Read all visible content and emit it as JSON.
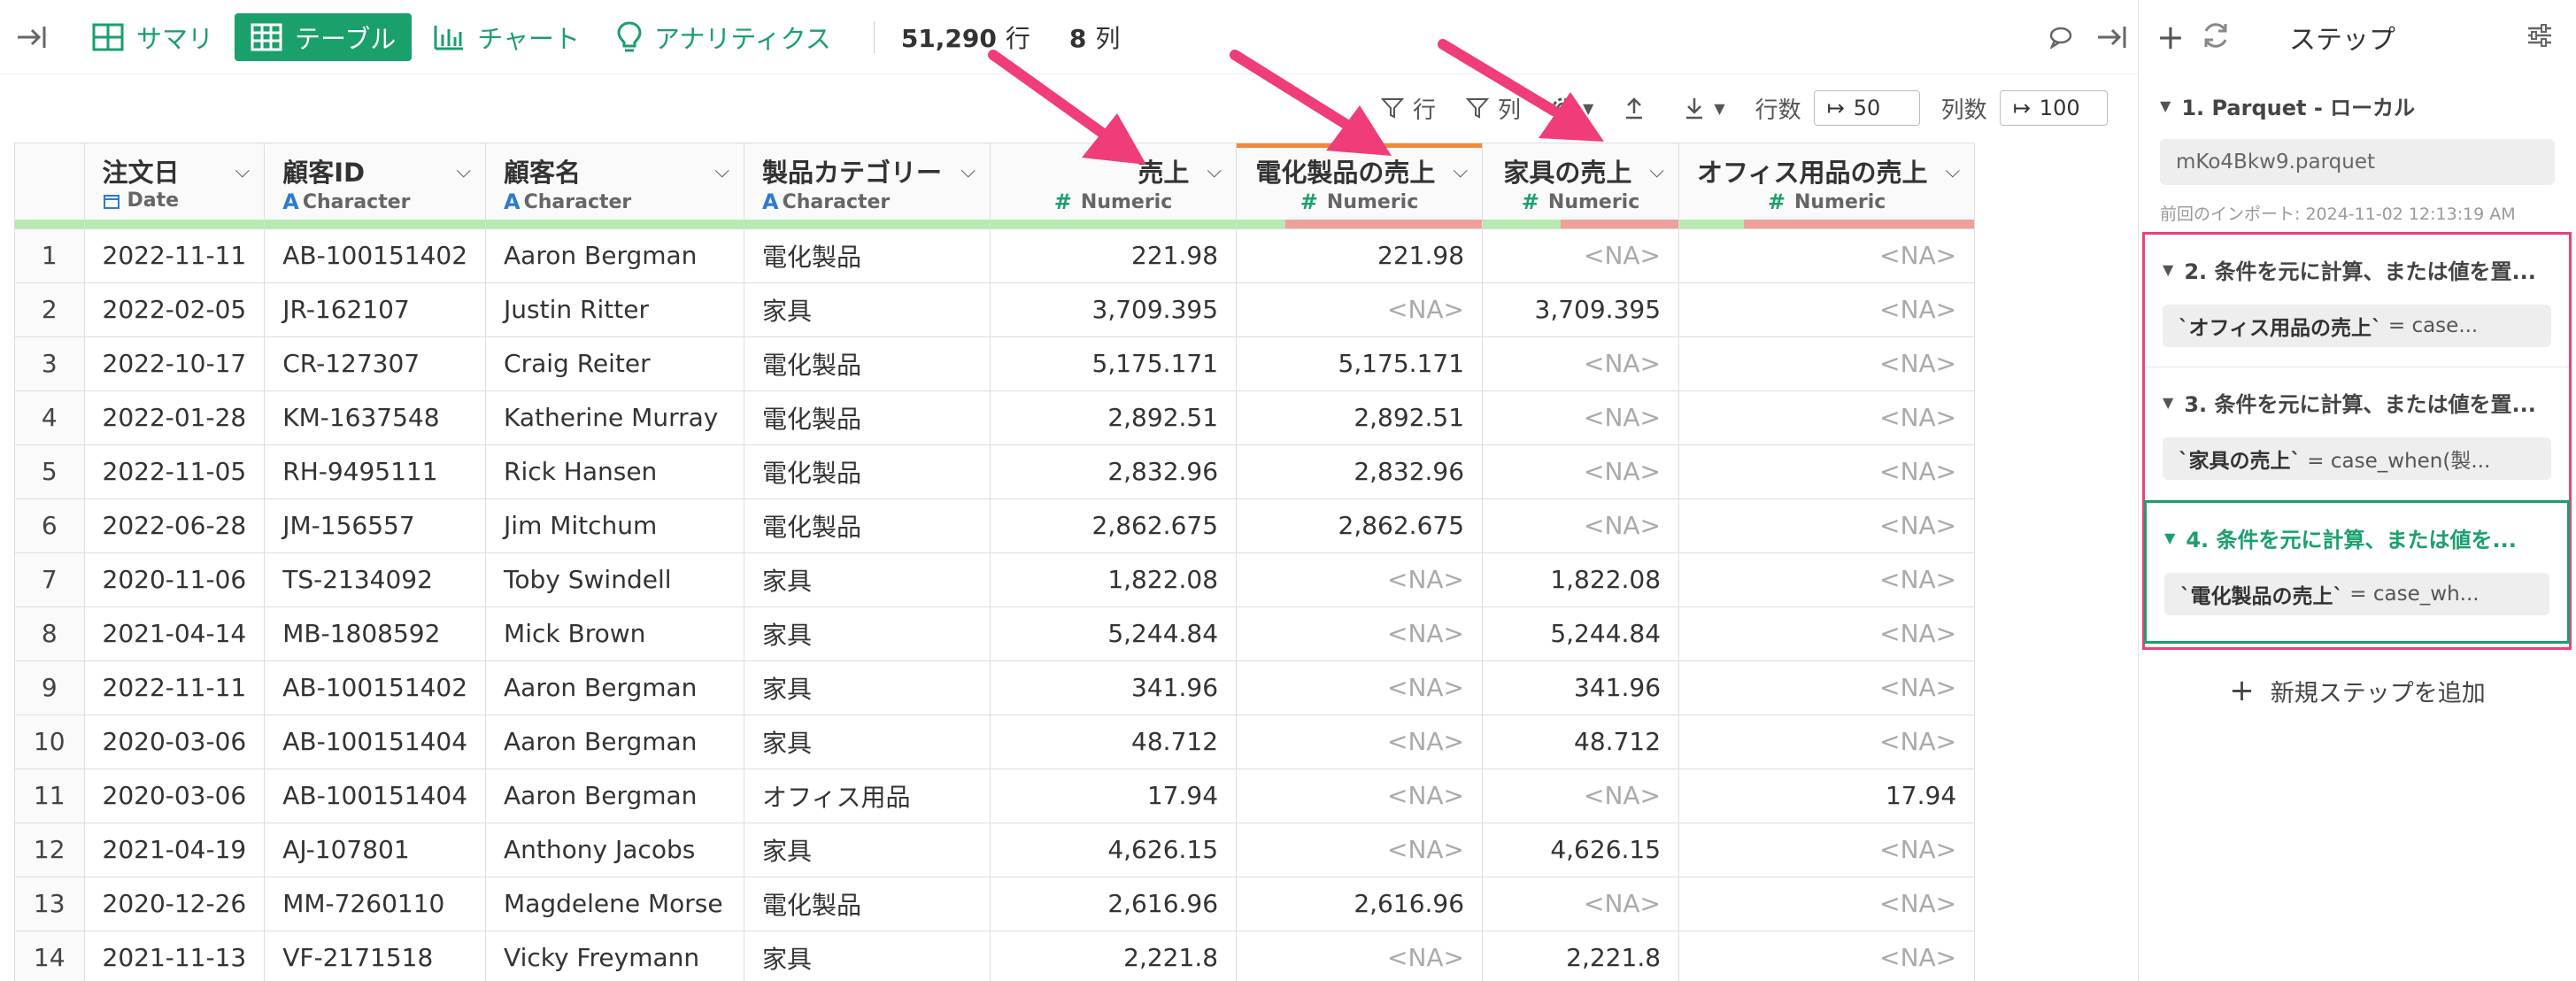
{
  "toolbar": {
    "views": [
      {
        "label": "サマリ",
        "icon": "summary-grid-icon"
      },
      {
        "label": "テーブル",
        "icon": "table-icon"
      },
      {
        "label": "チャート",
        "icon": "bar-chart-icon"
      },
      {
        "label": "アナリティクス",
        "icon": "lightbulb-icon"
      }
    ],
    "active_view": "テーブル",
    "row_count": "51,290",
    "row_unit": "行",
    "col_count": "8",
    "col_unit": "列"
  },
  "subbar": {
    "row_filter_label": "行",
    "col_filter_label": "列",
    "rows_label": "行数",
    "rows_value": "50",
    "cols_label": "列数",
    "cols_value": "100"
  },
  "table": {
    "columns": [
      {
        "name": "注文日",
        "type": "Date",
        "kind": "date"
      },
      {
        "name": "顧客ID",
        "type": "Character",
        "kind": "char"
      },
      {
        "name": "顧客名",
        "type": "Character",
        "kind": "char"
      },
      {
        "name": "製品カテゴリー",
        "type": "Character",
        "kind": "char"
      },
      {
        "name": "売上",
        "type": "Numeric",
        "kind": "num"
      },
      {
        "name": "電化製品の売上",
        "type": "Numeric",
        "kind": "num"
      },
      {
        "name": "家具の売上",
        "type": "Numeric",
        "kind": "num"
      },
      {
        "name": "オフィス用品の売上",
        "type": "Numeric",
        "kind": "num"
      }
    ],
    "rows": [
      [
        "1",
        "2022-11-11",
        "AB-100151402",
        "Aaron Bergman",
        "電化製品",
        "221.98",
        "221.98",
        "<NA>",
        "<NA>"
      ],
      [
        "2",
        "2022-02-05",
        "JR-162107",
        "Justin Ritter",
        "家具",
        "3,709.395",
        "<NA>",
        "3,709.395",
        "<NA>"
      ],
      [
        "3",
        "2022-10-17",
        "CR-127307",
        "Craig Reiter",
        "電化製品",
        "5,175.171",
        "5,175.171",
        "<NA>",
        "<NA>"
      ],
      [
        "4",
        "2022-01-28",
        "KM-1637548",
        "Katherine Murray",
        "電化製品",
        "2,892.51",
        "2,892.51",
        "<NA>",
        "<NA>"
      ],
      [
        "5",
        "2022-11-05",
        "RH-9495111",
        "Rick Hansen",
        "電化製品",
        "2,832.96",
        "2,832.96",
        "<NA>",
        "<NA>"
      ],
      [
        "6",
        "2022-06-28",
        "JM-156557",
        "Jim Mitchum",
        "電化製品",
        "2,862.675",
        "2,862.675",
        "<NA>",
        "<NA>"
      ],
      [
        "7",
        "2020-11-06",
        "TS-2134092",
        "Toby Swindell",
        "家具",
        "1,822.08",
        "<NA>",
        "1,822.08",
        "<NA>"
      ],
      [
        "8",
        "2021-04-14",
        "MB-1808592",
        "Mick Brown",
        "家具",
        "5,244.84",
        "<NA>",
        "5,244.84",
        "<NA>"
      ],
      [
        "9",
        "2022-11-11",
        "AB-100151402",
        "Aaron Bergman",
        "家具",
        "341.96",
        "<NA>",
        "341.96",
        "<NA>"
      ],
      [
        "10",
        "2020-03-06",
        "AB-100151404",
        "Aaron Bergman",
        "家具",
        "48.712",
        "<NA>",
        "48.712",
        "<NA>"
      ],
      [
        "11",
        "2020-03-06",
        "AB-100151404",
        "Aaron Bergman",
        "オフィス用品",
        "17.94",
        "<NA>",
        "<NA>",
        "17.94"
      ],
      [
        "12",
        "2021-04-19",
        "AJ-107801",
        "Anthony Jacobs",
        "家具",
        "4,626.15",
        "<NA>",
        "4,626.15",
        "<NA>"
      ],
      [
        "13",
        "2020-12-26",
        "MM-7260110",
        "Magdelene Morse",
        "電化製品",
        "2,616.96",
        "2,616.96",
        "<NA>",
        "<NA>"
      ],
      [
        "14",
        "2021-11-13",
        "VF-2171518",
        "Vicky Freymann",
        "家具",
        "2,221.8",
        "<NA>",
        "2,221.8",
        "<NA>"
      ]
    ]
  },
  "panel": {
    "title": "ステップ",
    "steps": [
      {
        "title": "1. Parquet - ローカル",
        "chip": "mKo4Bkw9.parquet",
        "meta": "前回のインポート: 2024-11-02 12:13:19 AM"
      },
      {
        "title": "2. 条件を元に計算、または値を置...",
        "chip_code": "`オフィス用品の売上`",
        "chip_rest": " = case..."
      },
      {
        "title": "3. 条件を元に計算、または値を置...",
        "chip_code": "`家具の売上`",
        "chip_rest": " = case_when(製..."
      },
      {
        "title": "4. 条件を元に計算、または値を...",
        "chip_code": "`電化製品の売上`",
        "chip_rest": " = case_wh..."
      }
    ],
    "add_step": "新規ステップを追加"
  },
  "colors": {
    "accent": "#1aa06b",
    "highlight": "#e8437a",
    "missing": "#f0a09a",
    "valid": "#b6eab1"
  }
}
